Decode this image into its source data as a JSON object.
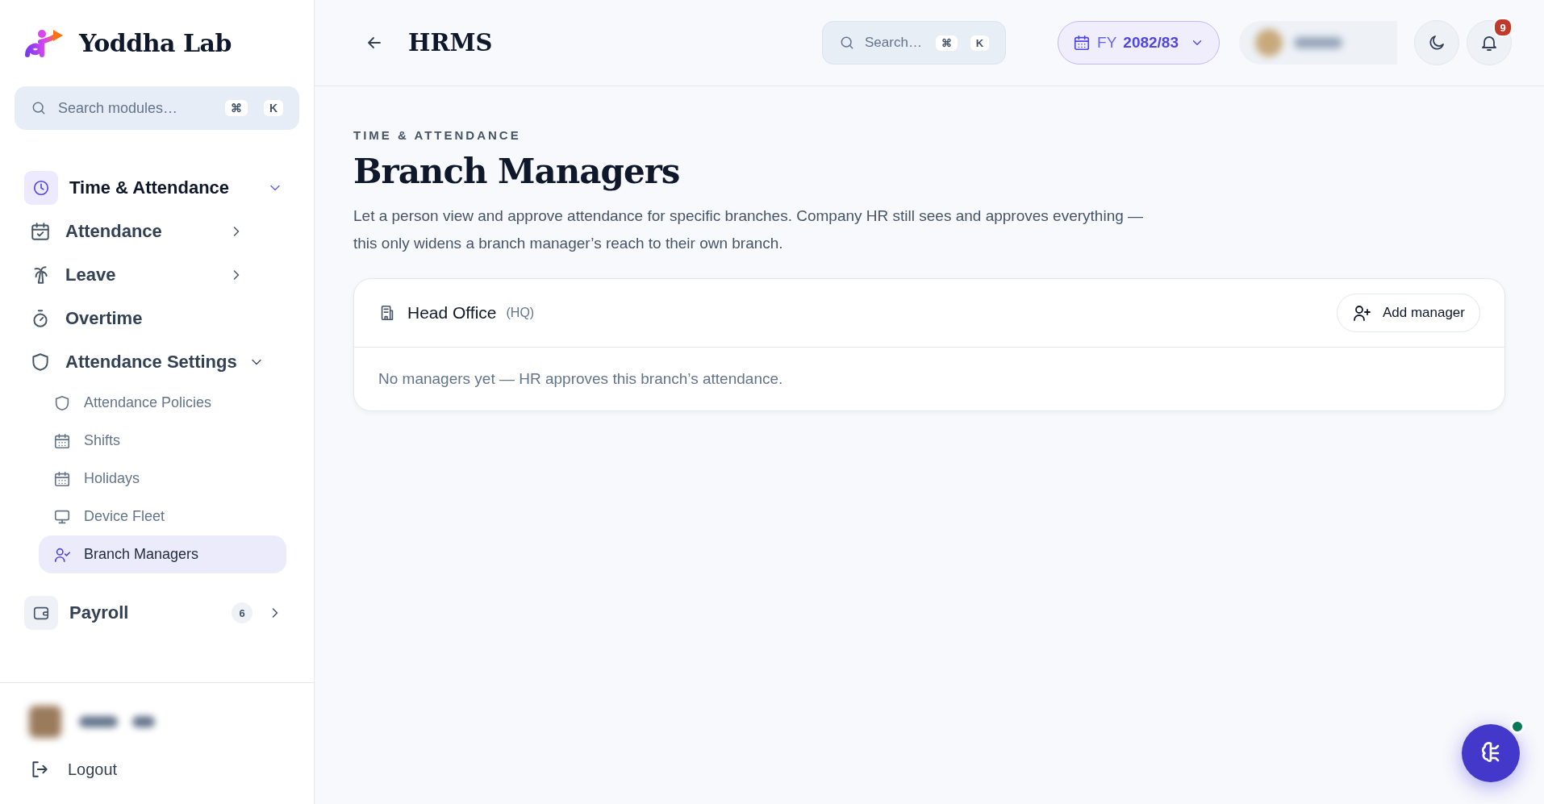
{
  "sidebar": {
    "brand": "Yoddha Lab",
    "search": {
      "placeholder": "Search modules…",
      "keys": [
        "⌘",
        "K"
      ]
    },
    "nav": [
      {
        "label": "Time & Attendance",
        "active": true,
        "expanded": true,
        "children": [
          {
            "label": "Attendance",
            "expanded": false
          },
          {
            "label": "Leave",
            "expanded": false
          },
          {
            "label": "Overtime"
          },
          {
            "label": "Attendance Settings",
            "expanded": true,
            "children": [
              {
                "label": "Attendance Policies",
                "selected": false
              },
              {
                "label": "Shifts",
                "selected": false
              },
              {
                "label": "Holidays",
                "selected": false
              },
              {
                "label": "Device Fleet",
                "selected": false
              },
              {
                "label": "Branch Managers",
                "selected": true
              }
            ]
          }
        ]
      },
      {
        "label": "Payroll",
        "active": false,
        "expanded": false,
        "badge": "6"
      }
    ],
    "logout": "Logout"
  },
  "header": {
    "title": "HRMS",
    "search": {
      "placeholder": "Search…",
      "keys": [
        "⌘",
        "K"
      ]
    },
    "fiscal_year": {
      "prefix": "FY",
      "value": "2082/83"
    },
    "notifications": "9"
  },
  "page": {
    "eyebrow": "TIME & ATTENDANCE",
    "title": "Branch Managers",
    "description": "Let a person view and approve attendance for specific branches. Company HR still sees and approves everything — this only widens a branch manager’s reach to their own branch.",
    "branches": [
      {
        "name": "Head Office",
        "code": "(HQ)",
        "action": "Add manager",
        "empty_text": "No managers yet — HR approves this branch’s attendance."
      }
    ]
  },
  "assistant": {
    "online": true
  }
}
